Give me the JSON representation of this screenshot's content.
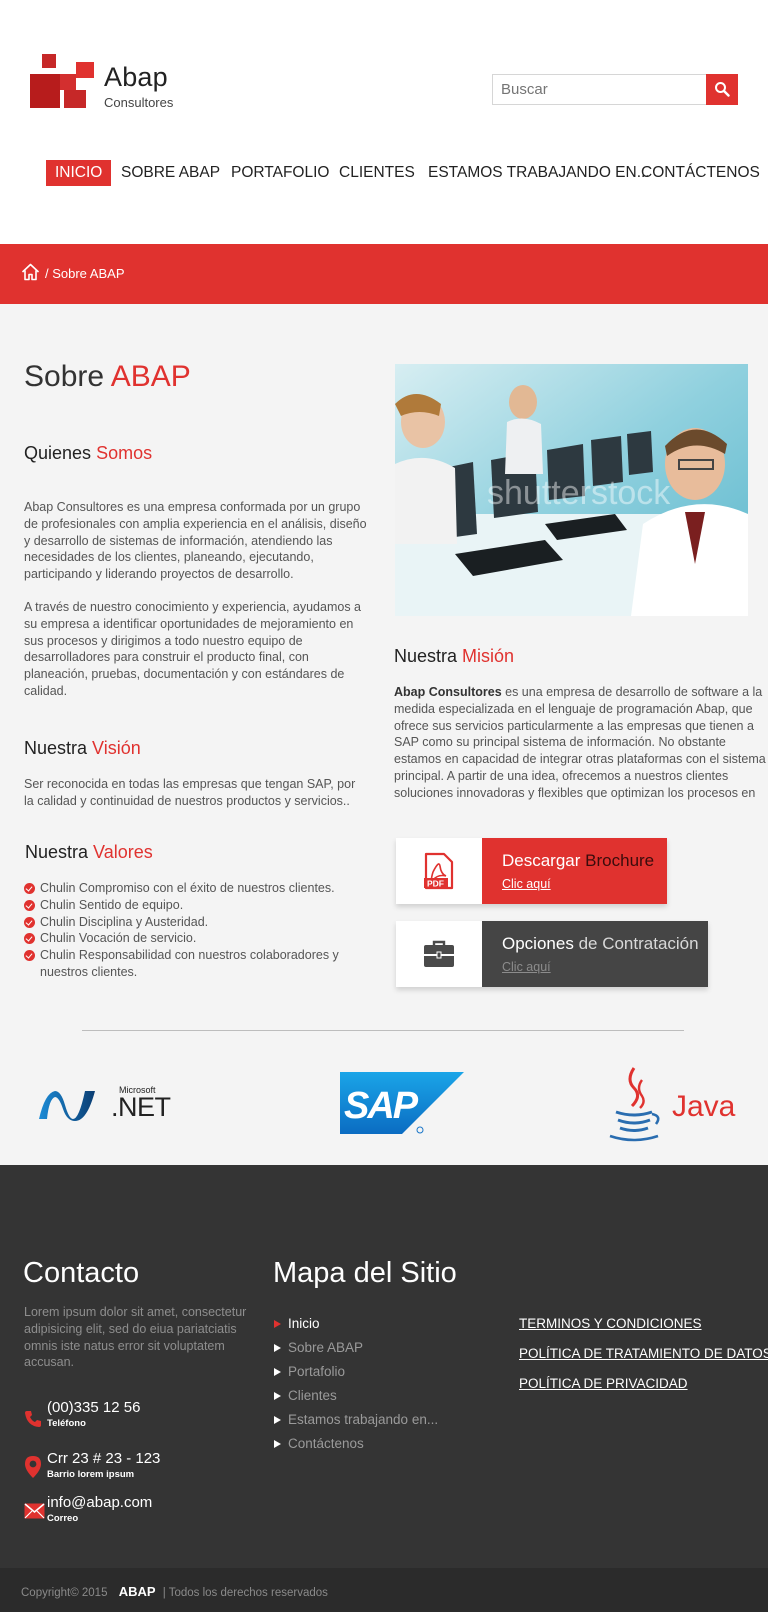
{
  "brand": {
    "name": "Abap",
    "subtitle": "Consultores"
  },
  "search": {
    "placeholder": "Buscar"
  },
  "nav": {
    "items": [
      "INICIO",
      "SOBRE ABAP",
      "PORTAFOLIO",
      "CLIENTES",
      "ESTAMOS TRABAJANDO EN...",
      "CONTÁCTENOS"
    ],
    "active_index": 0
  },
  "breadcrumb": {
    "current": "/ Sobre ABAP"
  },
  "colors": {
    "accent": "#e0322f",
    "dark": "#343434",
    "cta_dark": "#454545"
  },
  "about": {
    "title_prefix": "Sobre",
    "title_highlight": "ABAP",
    "quienes": {
      "prefix": "Quienes",
      "highlight": "Somos"
    },
    "para1": "Abap Consultores es una empresa conformada por un grupo de profesionales con amplia experiencia en el análisis, diseño y desarrollo de sistemas de información, atendiendo las necesidades de los clientes, planeando, ejecutando, participando y liderando proyectos de desarrollo.",
    "para2": "A través de nuestro conocimiento y experiencia, ayudamos a su empresa a identificar oportunidades de mejoramiento en sus procesos y dirigimos a todo nuestro equipo de desarrolladores para construir el producto final, con planeación, pruebas, documentación y con estándares de calidad.",
    "vision": {
      "prefix": "Nuestra",
      "highlight": "Visión",
      "text": "Ser reconocida en todas las empresas que tengan SAP, por la calidad y continuidad de nuestros productos y servicios.."
    },
    "valores": {
      "prefix": "Nuestra",
      "highlight": "Valores",
      "items": [
        "Chulin Compromiso con el éxito de nuestros clientes.",
        "Chulin Sentido de equipo.",
        "Chulin Disciplina y Austeridad.",
        "Chulin Vocación de servicio.",
        "Chulin Responsabilidad con nuestros colaboradores y nuestros clientes."
      ]
    },
    "mision": {
      "prefix": "Nuestra",
      "highlight": "Misión",
      "bold": "Abap Consultores",
      "text": " es una empresa de desarrollo de software a la medida especializada en el lenguaje de programación Abap, que ofrece sus servicios particularmente a las empresas que tienen a SAP como su principal sistema de información. No obstante estamos en capacidad de integrar otras plataformas con el sistema principal. A partir de una idea, ofrecemos a nuestros clientes soluciones innovadoras y flexibles que optimizan los procesos en las diferentes fases de su negocio."
    },
    "photo_watermark": "shutterstock"
  },
  "cta": {
    "brochure": {
      "prefix": "Descargar",
      "highlight": "Brochure",
      "link": "Clic aquí",
      "icon": "pdf-icon",
      "icon_label": "PDF"
    },
    "contratacion": {
      "prefix": "Opciones",
      "highlight": "de Contratación",
      "link": "Clic aquí",
      "icon": "briefcase-icon"
    }
  },
  "partners": {
    "net": {
      "top": "Microsoft",
      "main": ".NET"
    },
    "sap": {
      "main": "SAP"
    },
    "java": {
      "main": "Java"
    }
  },
  "footer": {
    "contacto": {
      "title": "Contacto",
      "lorem": "Lorem ipsum dolor sit amet, consectetur adipisicing elit, sed do eiua pariatciatis omnis iste natus error sit voluptatem accusan.",
      "phone": "(00)335 12 56",
      "phone_label": "Teléfono",
      "address": "Crr 23 # 23 - 123",
      "address_label": "Barrio lorem ipsum",
      "email": "info@abap.com",
      "email_label": "Correo"
    },
    "mapa": {
      "title": "Mapa del Sitio",
      "items": [
        "Inicio",
        "Sobre ABAP",
        "Portafolio",
        "Clientes",
        "Estamos trabajando en...",
        "Contáctenos"
      ]
    },
    "legal": [
      "TERMINOS Y CONDICIONES",
      "POLÍTICA DE TRATAMIENTO DE DATOS",
      "POLÍTICA DE PRIVACIDAD"
    ],
    "copyright": "Copyright© 2015",
    "copyright_brand": "ABAP",
    "rights": "| Todos los derechos reservados"
  }
}
